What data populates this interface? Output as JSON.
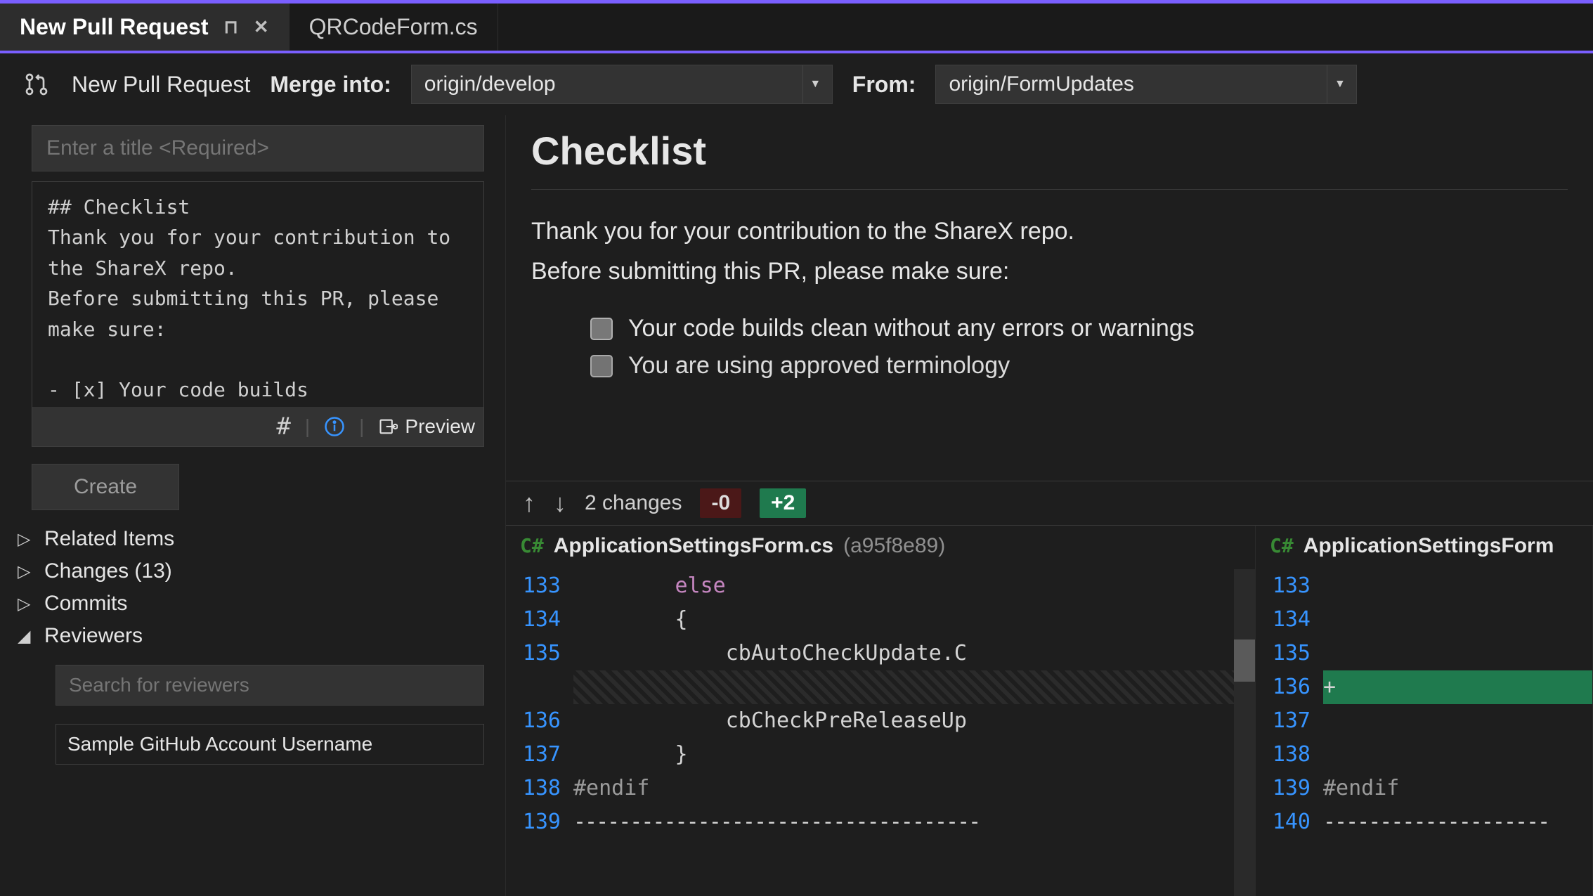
{
  "tabs": {
    "active": "New Pull Request",
    "inactive": "QRCodeForm.cs"
  },
  "branchbar": {
    "page_label": "New Pull Request",
    "merge_label": "Merge into:",
    "merge_value": "origin/develop",
    "from_label": "From:",
    "from_value": "origin/FormUpdates"
  },
  "form": {
    "title_placeholder": "Enter a title <Required>",
    "description": "## Checklist\nThank you for your contribution to the ShareX repo.\nBefore submitting this PR, please make sure:\n\n- [x] Your code builds",
    "preview_label": "Preview",
    "create_label": "Create"
  },
  "tree": {
    "related": "Related Items",
    "changes": "Changes (13)",
    "commits": "Commits",
    "reviewers": "Reviewers",
    "reviewer_search_placeholder": "Search for reviewers",
    "reviewer_sample": "Sample GitHub Account Username"
  },
  "preview": {
    "heading": "Checklist",
    "line1": "Thank you for your contribution to the ShareX repo.",
    "line2": "Before submitting this PR, please make sure:",
    "check1": "Your code builds clean without any errors or warnings",
    "check2": "You are using approved terminology"
  },
  "diff": {
    "changes_label": "2 changes",
    "deletions": "-0",
    "additions": "+2",
    "file": "ApplicationSettingsForm.cs",
    "sha": "(a95f8e89)",
    "file_right": "ApplicationSettingsForm",
    "left": {
      "lines": [
        "133",
        "134",
        "135",
        "",
        "136",
        "137",
        "138",
        "139"
      ],
      "code": {
        "l133": "        else",
        "l134": "        {",
        "l135": "            cbAutoCheckUpdate.C",
        "gap": "",
        "l136": "            cbCheckPreReleaseUp",
        "l137": "        }",
        "l138": "#endif",
        "l139": "------------------------------------"
      }
    },
    "right": {
      "lines": [
        "133",
        "134",
        "135",
        "136",
        "137",
        "138",
        "139",
        "140"
      ],
      "code": {
        "added_marker": "+",
        "l139": "#endif"
      }
    }
  }
}
